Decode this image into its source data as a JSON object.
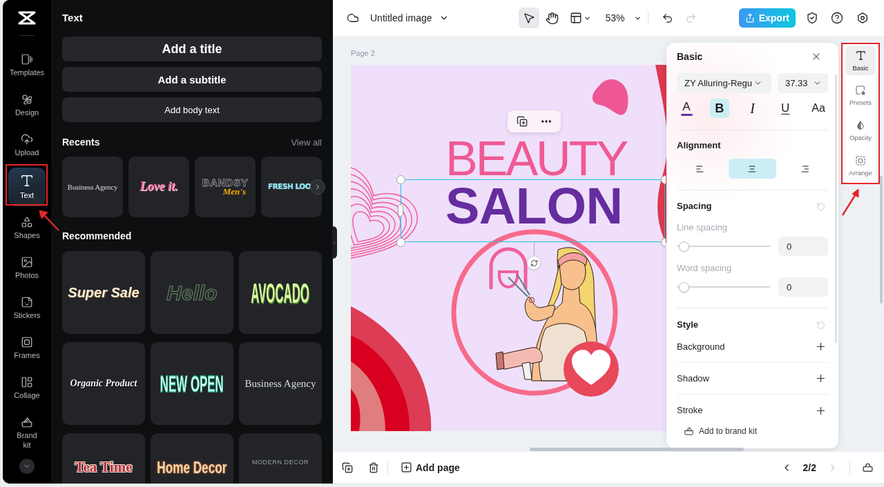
{
  "sidebar": {
    "items": [
      {
        "label": "Templates",
        "selected": false
      },
      {
        "label": "Design",
        "selected": false
      },
      {
        "label": "Upload",
        "selected": false
      },
      {
        "label": "Text",
        "selected": true
      },
      {
        "label": "Shapes",
        "selected": false
      },
      {
        "label": "Photos",
        "selected": false
      },
      {
        "label": "Stickers",
        "selected": false
      },
      {
        "label": "Frames",
        "selected": false
      },
      {
        "label": "Collage",
        "selected": false
      },
      {
        "label": "Brand kit",
        "selected": false
      }
    ]
  },
  "text_panel": {
    "title": "Text",
    "add_buttons": [
      {
        "kind": "title",
        "label": "Add a title"
      },
      {
        "kind": "subtitle",
        "label": "Add a subtitle"
      },
      {
        "kind": "body",
        "label": "Add body text"
      }
    ],
    "recents": {
      "title": "Recents",
      "link": "View all",
      "items": [
        {
          "kind": "serif",
          "text": "Business Agency"
        },
        {
          "kind": "love",
          "text": "Love it."
        },
        {
          "kind": "duo",
          "text": "BANDSY",
          "subtext": "Men's"
        },
        {
          "kind": "fresh",
          "text": "FRESH LOO"
        }
      ]
    },
    "recommended": {
      "title": "Recommended",
      "items": [
        {
          "kind": "sale",
          "text": "Super Sale"
        },
        {
          "kind": "outline",
          "text": "Hello"
        },
        {
          "kind": "avocado",
          "text": "AVOCADO"
        },
        {
          "kind": "script",
          "text": "Organic Product"
        },
        {
          "kind": "neon",
          "text": "NEW OPEN"
        },
        {
          "kind": "agency",
          "text": "Business Agency"
        },
        {
          "kind": "tea",
          "text": "Tea Time"
        },
        {
          "kind": "decor",
          "text": "Home Decor"
        },
        {
          "kind": "modern",
          "text": "MODERN DECOR"
        }
      ]
    }
  },
  "top_bar": {
    "document_title": "Untitled image",
    "tools": [
      {
        "selected": true
      },
      {
        "selected": false
      }
    ],
    "zoom": "53%",
    "undo": {
      "disabled": false
    },
    "redo": {
      "disabled": true
    },
    "export": "Export"
  },
  "canvas": {
    "page_label": "Page 2",
    "headline": "BEAUTY",
    "title": "SALON"
  },
  "properties_panel": {
    "title": "Basic",
    "font": "ZY Alluring-Regu",
    "size": "37.33",
    "format": [
      {
        "kind": "color",
        "label": "A",
        "color": "#6b2fa3",
        "selected": false
      },
      {
        "kind": "bold",
        "label": "B",
        "selected": true
      },
      {
        "kind": "italic",
        "label": "I",
        "selected": false
      },
      {
        "kind": "underline",
        "label": "U",
        "selected": false
      },
      {
        "kind": "case",
        "label": "Aa",
        "selected": false
      }
    ],
    "alignment": {
      "title": "Alignment",
      "options": [
        {
          "selected": false
        },
        {
          "selected": true
        },
        {
          "selected": false
        }
      ]
    },
    "spacing": {
      "title": "Spacing",
      "sliders": [
        {
          "label": "Line spacing",
          "level": 0,
          "value": "0"
        },
        {
          "label": "Word spacing",
          "level": 0,
          "value": "0"
        }
      ]
    },
    "style": {
      "title": "Style",
      "rows": [
        "Background",
        "Shadow",
        "Stroke"
      ]
    },
    "footer": "Add to brand kit"
  },
  "right_rail": {
    "items": [
      {
        "label": "Basic",
        "selected": true
      },
      {
        "label": "Presets",
        "selected": false
      },
      {
        "label": "Opacity",
        "selected": false
      },
      {
        "label": "Arrange",
        "selected": false
      }
    ]
  },
  "bottom_bar": {
    "add_page": "Add page",
    "page_indicator": "2/2",
    "prev": {
      "disabled": false
    },
    "next": {
      "disabled": true
    }
  }
}
